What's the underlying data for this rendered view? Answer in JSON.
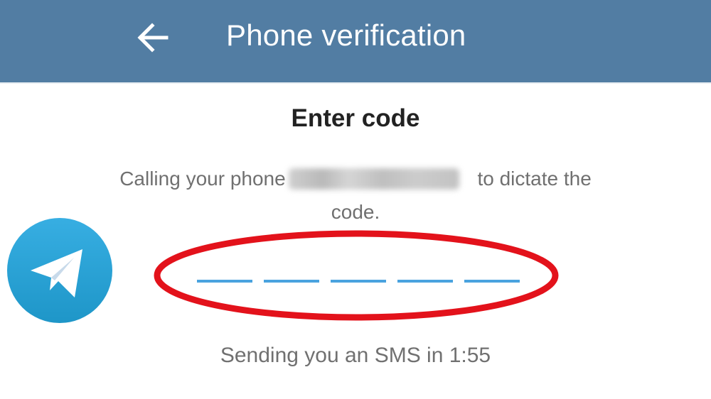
{
  "header": {
    "title": "Phone verification",
    "back_icon": "arrow-left-icon",
    "background_color": "#527da3"
  },
  "main": {
    "heading": "Enter code",
    "description_prefix": "Calling your phone",
    "description_suffix": " to dictate the",
    "description_line2": "code.",
    "phone_number_redacted": true,
    "code_slots": 5,
    "code_value": "",
    "sms_timer": "Sending you an SMS in 1:55"
  },
  "overlay": {
    "logo_icon": "telegram-logo-icon",
    "highlight": "red-ellipse",
    "highlight_color": "#e3121b"
  },
  "colors": {
    "accent": "#4aa3df",
    "text_secondary": "#707070",
    "text_primary": "#222222"
  }
}
